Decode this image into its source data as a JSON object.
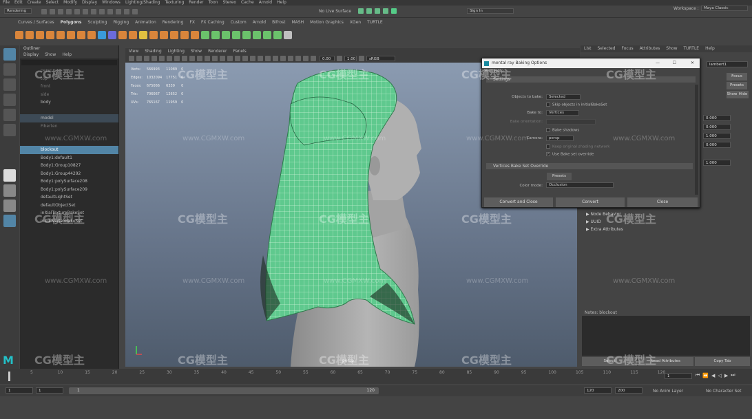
{
  "menubar": [
    "File",
    "Edit",
    "Create",
    "Select",
    "Modify",
    "Display",
    "Windows",
    "Lighting/Shading",
    "Texturing",
    "Render",
    "Toon",
    "Stereo",
    "Cache",
    "Arnold",
    "Help"
  ],
  "status": {
    "mode": "Rendering",
    "live_surface": "No Live Surface",
    "sign_in": "Sign In",
    "workspace_label": "Workspace :",
    "workspace": "Maya Classic"
  },
  "shelf_tabs": [
    "Curves / Surfaces",
    "Polygons",
    "Sculpting",
    "Rigging",
    "Animation",
    "Rendering",
    "FX",
    "FX Caching",
    "Custom",
    "Arnold",
    "Bifrost",
    "MASH",
    "Motion Graphics",
    "XGen",
    "TURTLE"
  ],
  "shelf_colors": [
    "#d9853b",
    "#d9853b",
    "#d9853b",
    "#d9853b",
    "#d9853b",
    "#d9853b",
    "#d9853b",
    "#d9853b",
    "#3a9ad9",
    "#6b6bd9",
    "#d9853b",
    "#d9853b",
    "#e0c040",
    "#d9853b",
    "#d9853b",
    "#d9853b",
    "#d9853b",
    "#d9853b",
    "#6bc26b",
    "#6bc26b",
    "#6bc26b",
    "#6bc26b",
    "#6bc26b",
    "#6bc26b",
    "#6bc26b",
    "#6bc26b",
    "#c0c0c0"
  ],
  "outliner": {
    "title": "Outliner",
    "menu": [
      "Display",
      "Show",
      "Help"
    ],
    "items": [
      {
        "label": "persp",
        "state": "dim"
      },
      {
        "label": "top",
        "state": "dim"
      },
      {
        "label": "front",
        "state": "dim"
      },
      {
        "label": "side",
        "state": "dim"
      },
      {
        "label": "body",
        "state": ""
      },
      {
        "label": "",
        "state": "dim"
      },
      {
        "label": "model",
        "state": "hl"
      },
      {
        "label": "Fiberten",
        "state": "dim"
      },
      {
        "label": "",
        "state": "dim"
      },
      {
        "label": "",
        "state": "dim"
      },
      {
        "label": "blockout",
        "state": "sel"
      },
      {
        "label": "Body1:default1",
        "state": ""
      },
      {
        "label": "Body1:Group10827",
        "state": ""
      },
      {
        "label": "Body1:Group44292",
        "state": ""
      },
      {
        "label": "Body1:polySurface208",
        "state": ""
      },
      {
        "label": "Body1:polySurface209",
        "state": ""
      },
      {
        "label": "defaultLightSet",
        "state": ""
      },
      {
        "label": "defaultObjectSet",
        "state": ""
      },
      {
        "label": "initialTextureBakeSet",
        "state": ""
      },
      {
        "label": "initialVertexBakeSet",
        "state": ""
      }
    ]
  },
  "viewport": {
    "menu": [
      "View",
      "Shading",
      "Lighting",
      "Show",
      "Renderer",
      "Panels"
    ],
    "exposure": "0.00",
    "gamma": "1.00",
    "color_space": "sRGB gamma",
    "camera_label": "persp",
    "hud": [
      {
        "label": "Verts:",
        "v1": "566993",
        "v2": "11089",
        "v3": "0"
      },
      {
        "label": "Edges:",
        "v1": "1032094",
        "v2": "17751",
        "v3": "0"
      },
      {
        "label": "Faces:",
        "v1": "675066",
        "v2": "6339",
        "v3": "0"
      },
      {
        "label": "Tris:",
        "v1": "706067",
        "v2": "12652",
        "v3": "0"
      },
      {
        "label": "UVs:",
        "v1": "765167",
        "v2": "11959",
        "v3": "0"
      }
    ]
  },
  "bake_dialog": {
    "title": "mental ray Baking Options",
    "menu": "Edit   Help",
    "settings": "Settings",
    "objects_label": "Objects to bake:",
    "objects_value": "Selected",
    "skip_label": "Skip objects in initialBakeSet",
    "bake_to_label": "Bake to:",
    "bake_to_value": "Vertices",
    "bake_orient_label": "Bake orientation:",
    "bake_shadows_label": "Bake shadows",
    "camera_label": "Camera:",
    "camera_value": "persp",
    "keep_label": "Keep original shading network",
    "use_override_label": "Use Bake set override",
    "override_section": "Vertices Bake Set Override",
    "presets": "Presets",
    "color_mode_label": "Color mode:",
    "color_mode_value": "Occlusion",
    "btn_convert_close": "Convert and Close",
    "btn_convert": "Convert",
    "btn_close": "Close"
  },
  "attr_editor": {
    "menu": [
      "List",
      "Selected",
      "Focus",
      "Attributes",
      "Show",
      "TURTLE",
      "Help"
    ],
    "node_name": "lambert1",
    "focus": "Focus",
    "presets": "Presets",
    "show": "Show",
    "hide": "Hide",
    "values": [
      "0.000",
      "0.000",
      "1.000",
      "0.000",
      "1.000"
    ],
    "sections": [
      "Node Behavior",
      "UUID",
      "Extra Attributes"
    ],
    "notes_label": "Notes: blockout",
    "btn_select": "Select",
    "btn_load": "Load Attributes",
    "btn_copy": "Copy Tab"
  },
  "timeline": {
    "current_frame": "1",
    "range_start": "1",
    "range_inner_start": "1",
    "range_inner_end": "120",
    "range_end": "120",
    "anim_end": "200",
    "anim_layer": "No Anim Layer",
    "char_set": "No Character Set",
    "ticks": [
      "5",
      "10",
      "15",
      "20",
      "25",
      "30",
      "35",
      "40",
      "45",
      "50",
      "55",
      "60",
      "65",
      "70",
      "75",
      "80",
      "85",
      "90",
      "95",
      "100",
      "105",
      "110",
      "115",
      "120"
    ]
  },
  "watermark": {
    "brand": "CG模型主",
    "url": "www.CGMXW.com"
  }
}
